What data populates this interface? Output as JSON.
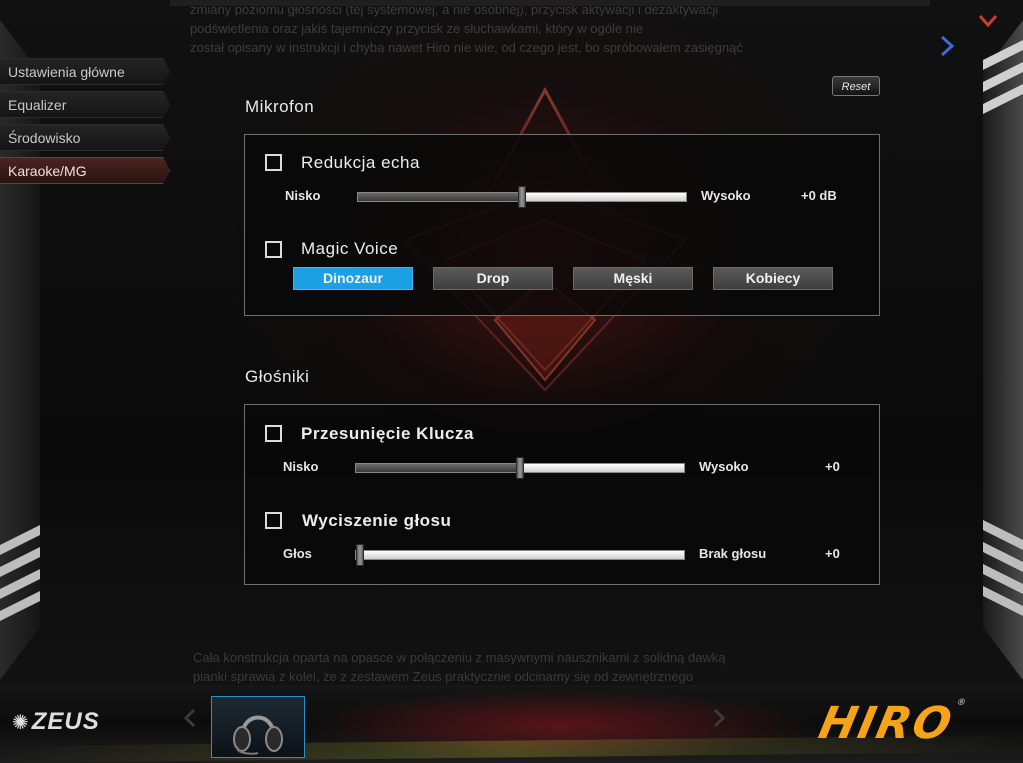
{
  "background_text": {
    "top_lines": [
      "zmiany poziomu głośności (tej systemowej, a nie osobnej), przycisk aktywacji i dezaktywacji",
      "podświetlenia oraz jakiś tajemniczy przycisk ze słuchawkami, który w ogóle nie",
      "został opisany w instrukcji i chyba nawet Hiro nie wie, od czego jest, bo spróbowałem zasięgnąć"
    ],
    "bottom_lines": [
      "Cała konstrukcja oparta na opasce w połączeniu z masywnymi nausznikami z solidną dawką",
      "pianki sprawia z kolei, że z zestawem Zeus praktycznie odcinamy się od zewnętrznego"
    ]
  },
  "nav": {
    "items": [
      {
        "label": "Ustawienia główne",
        "active": false
      },
      {
        "label": "Equalizer",
        "active": false
      },
      {
        "label": "Środowisko",
        "active": false
      },
      {
        "label": "Karaoke/MG",
        "active": true
      }
    ]
  },
  "reset_label": "Reset",
  "microphone": {
    "title": "Mikrofon",
    "echo": {
      "label": "Redukcja echa",
      "checked": false,
      "min_label": "Nisko",
      "max_label": "Wysoko",
      "value_label": "+0 dB",
      "position": 0.5
    },
    "magic_voice": {
      "label": "Magic Voice",
      "checked": false,
      "buttons": [
        {
          "label": "Dinozaur",
          "active": true
        },
        {
          "label": "Drop",
          "active": false
        },
        {
          "label": "Męski",
          "active": false
        },
        {
          "label": "Kobiecy",
          "active": false
        }
      ]
    }
  },
  "speakers": {
    "title": "Głośniki",
    "key_shift": {
      "label": "Przesunięcie Klucza",
      "checked": false,
      "min_label": "Nisko",
      "max_label": "Wysoko",
      "value_label": "+0",
      "position": 0.5
    },
    "voice_mute": {
      "label": "Wyciszenie głosu",
      "checked": false,
      "min_label": "Głos",
      "max_label": "Brak głosu",
      "value_label": "+0",
      "position": 0.0
    }
  },
  "brand": {
    "left_logo": "ZEUS",
    "right_logo": "HIRO",
    "right_logo_mark": "®",
    "accent_color": "#1ba0e6",
    "hiro_color": "#f4a416"
  }
}
